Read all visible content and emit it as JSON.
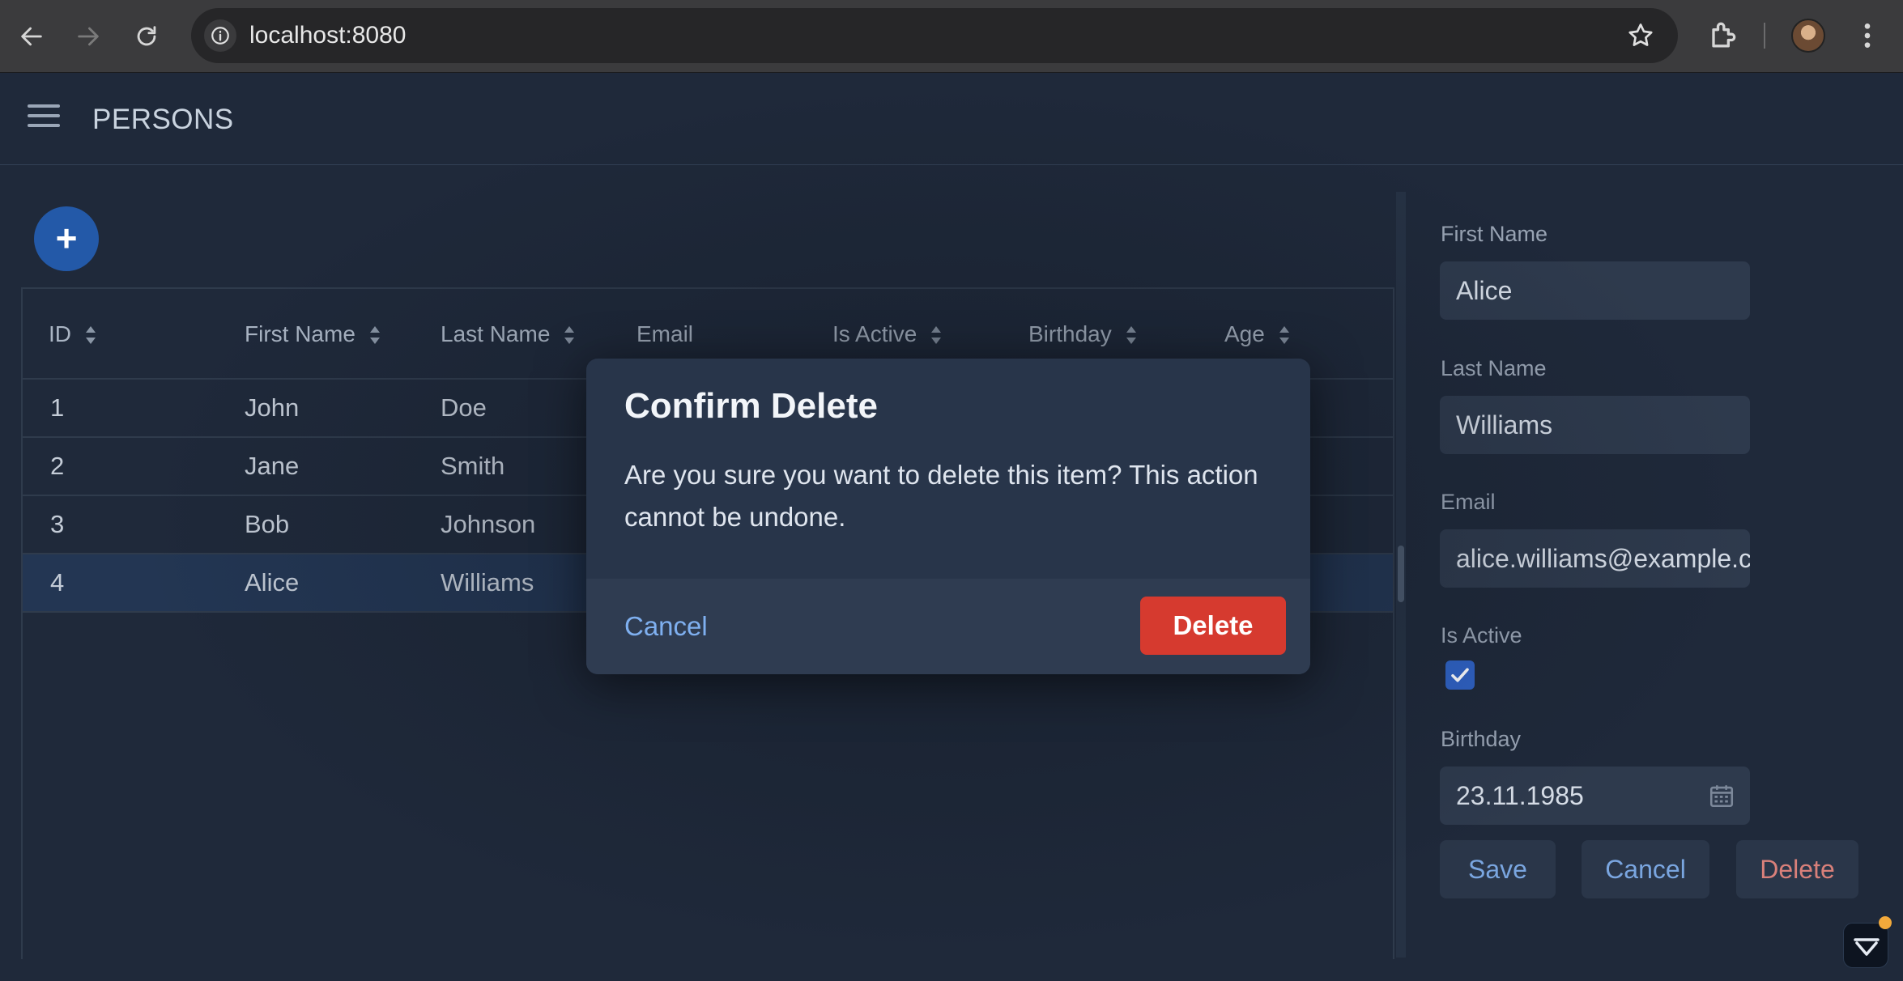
{
  "browser": {
    "url": "localhost:8080",
    "icons": [
      "back-icon",
      "forward-icon",
      "reload-icon",
      "site-info-icon",
      "bookmark-star-icon",
      "extensions-icon",
      "profile-avatar",
      "menu-kebab-icon"
    ]
  },
  "app": {
    "title": "PERSONS",
    "add_label": "+"
  },
  "grid": {
    "columns": [
      "ID",
      "First Name",
      "Last Name",
      "Email",
      "Is Active",
      "Birthday",
      "Age"
    ],
    "rows": [
      {
        "id": "1",
        "first": "John",
        "last": "Doe"
      },
      {
        "id": "2",
        "first": "Jane",
        "last": "Smith"
      },
      {
        "id": "3",
        "first": "Bob",
        "last": "Johnson"
      },
      {
        "id": "4",
        "first": "Alice",
        "last": "Williams"
      }
    ],
    "selected_row": 4
  },
  "form": {
    "first_name_label": "First Name",
    "first_name_value": "Alice",
    "last_name_label": "Last Name",
    "last_name_value": "Williams",
    "email_label": "Email",
    "email_value": "alice.williams@example.com",
    "is_active_label": "Is Active",
    "is_active": true,
    "birthday_label": "Birthday",
    "birthday_value": "23.11.1985",
    "save_label": "Save",
    "cancel_label": "Cancel",
    "delete_label": "Delete"
  },
  "dialog": {
    "title": "Confirm Delete",
    "message": "Are you sure you want to delete this item? This action cannot be undone.",
    "cancel_label": "Cancel",
    "delete_label": "Delete"
  },
  "colors": {
    "background": "#1f293a",
    "accent": "#2359a8",
    "danger": "#d63a2f",
    "link": "#7fb0f0"
  }
}
